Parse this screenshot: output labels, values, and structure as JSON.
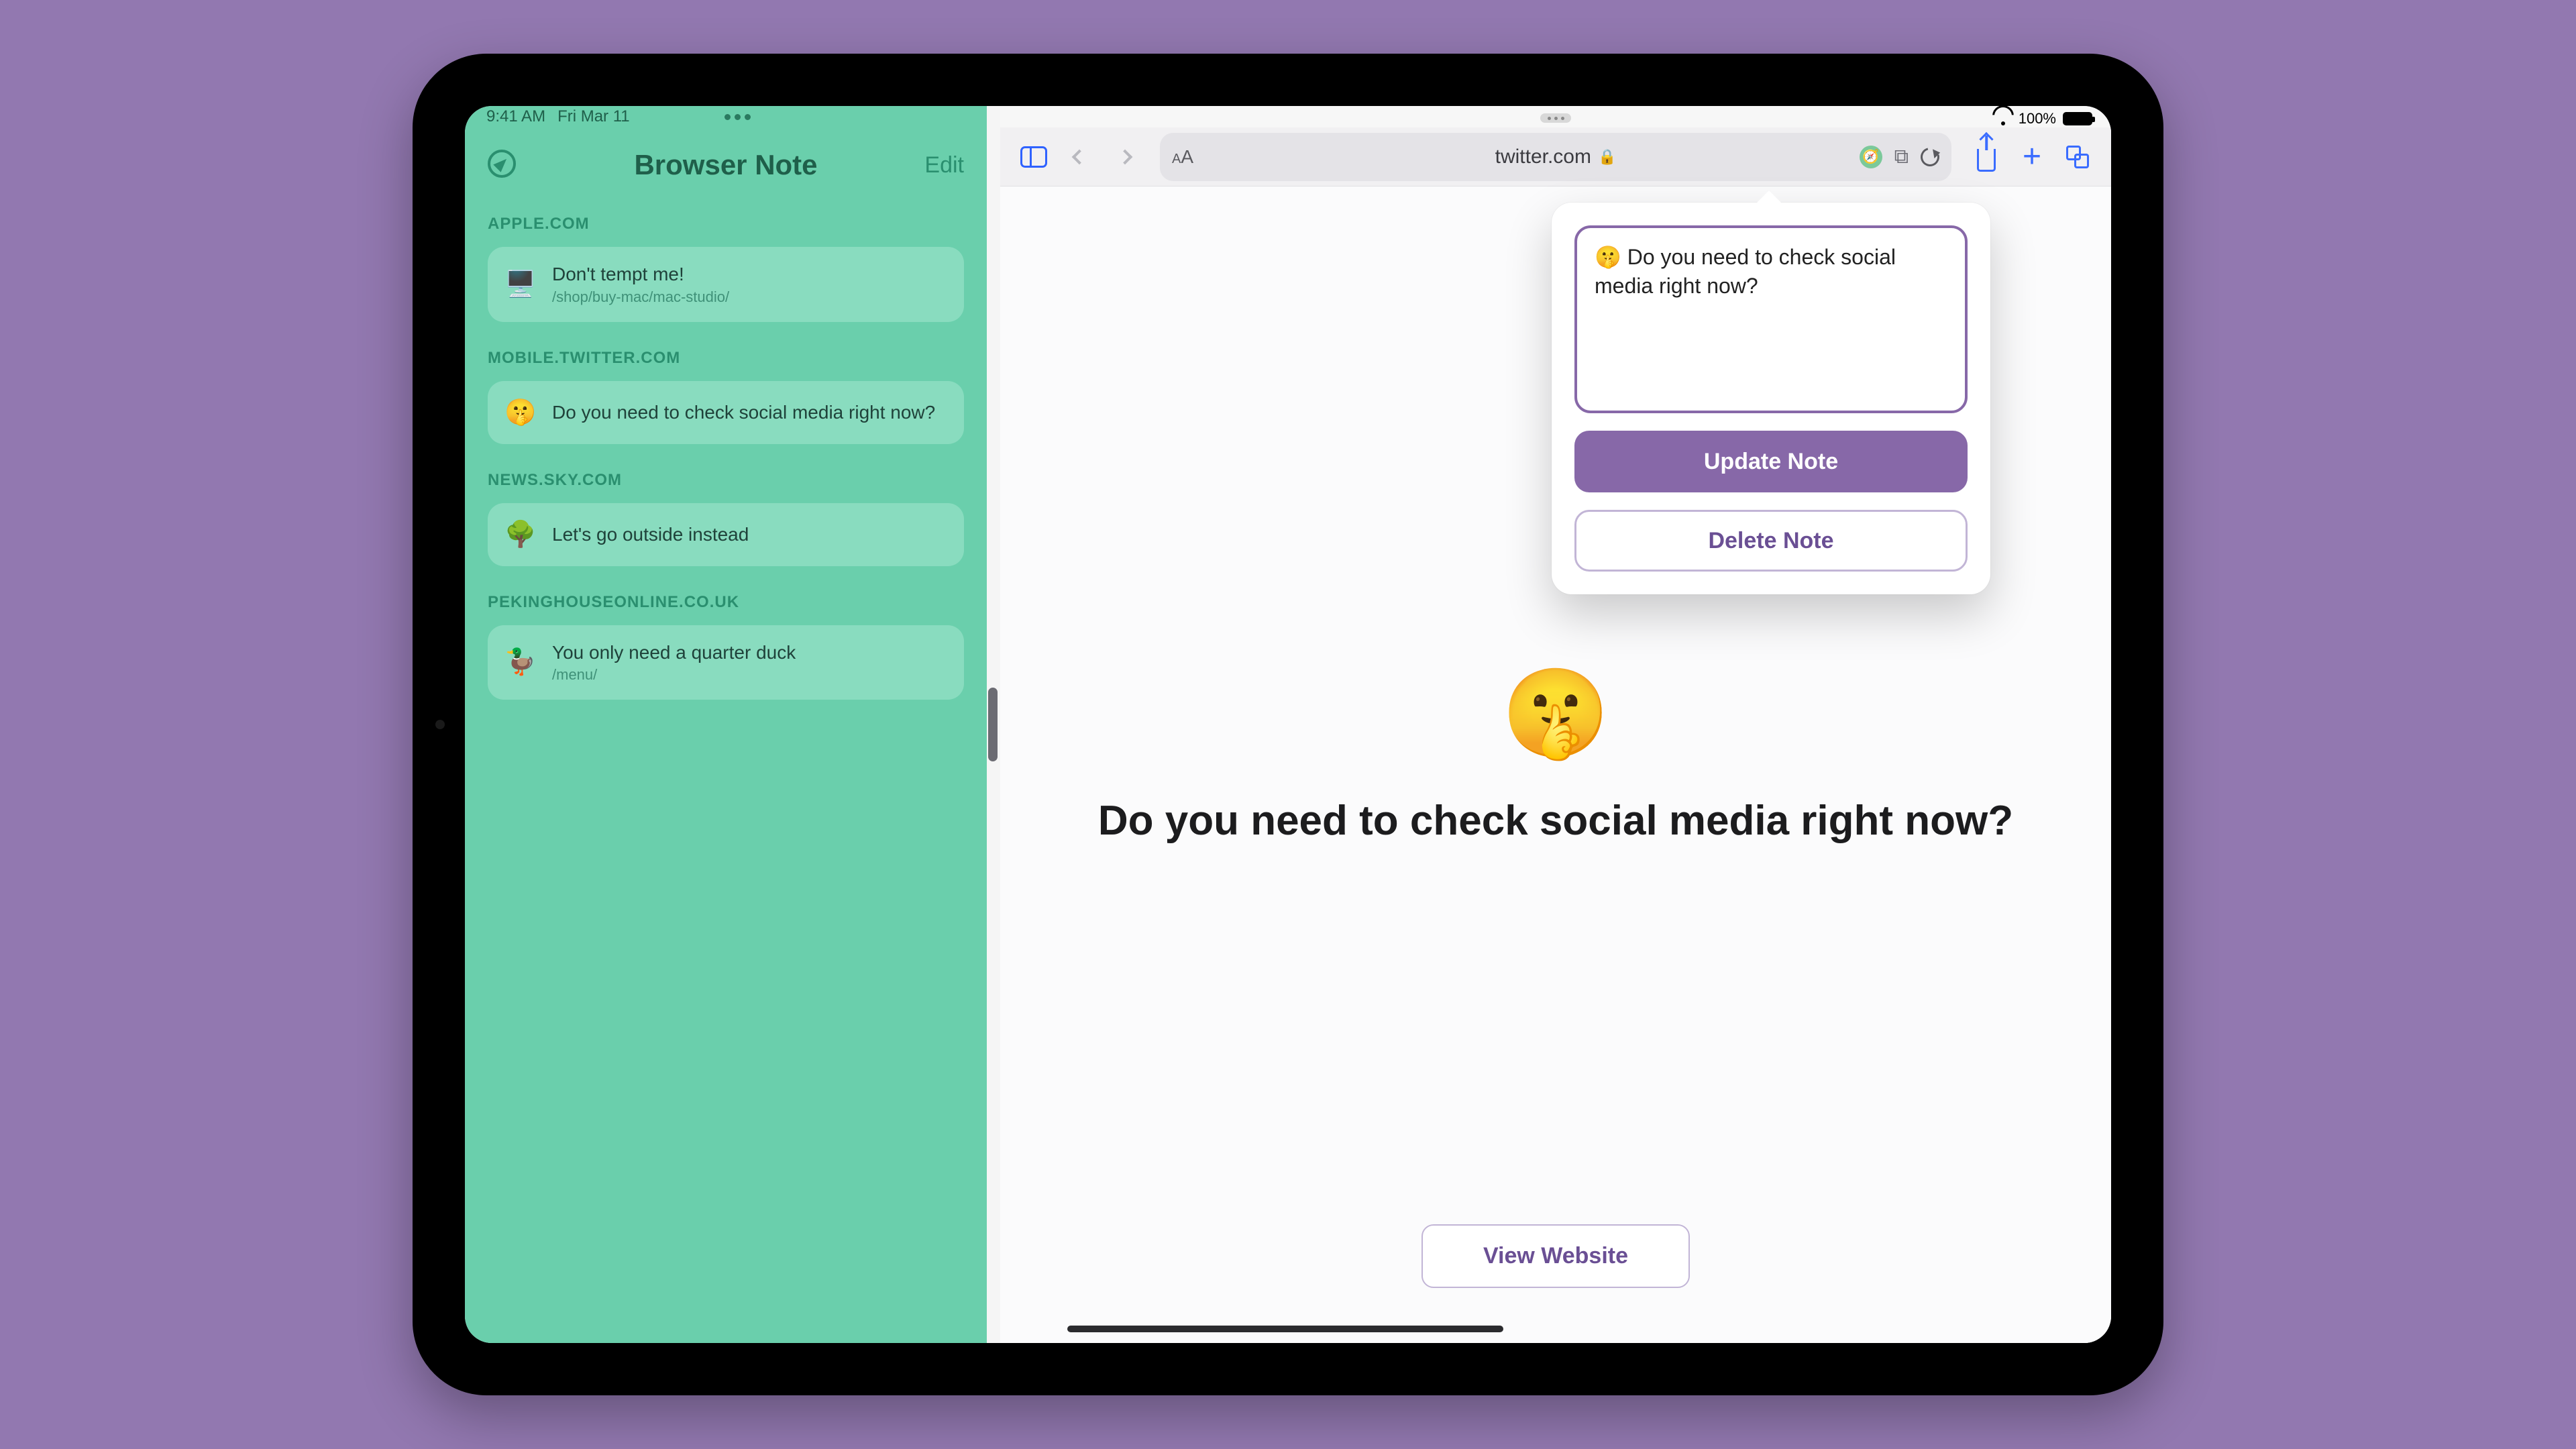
{
  "status": {
    "time": "9:41 AM",
    "date": "Fri Mar 11",
    "battery_pct": "100%"
  },
  "left_app": {
    "title": "Browser Note",
    "edit_label": "Edit",
    "sections": [
      {
        "domain": "APPLE.COM",
        "emoji": "🖥️",
        "title": "Don't tempt me!",
        "subtitle": "/shop/buy-mac/mac-studio/"
      },
      {
        "domain": "MOBILE.TWITTER.COM",
        "emoji": "🤫",
        "title": "Do you need to check social media right now?",
        "subtitle": ""
      },
      {
        "domain": "NEWS.SKY.COM",
        "emoji": "🌳",
        "title": "Let's go outside instead",
        "subtitle": ""
      },
      {
        "domain": "PEKINGHOUSEONLINE.CO.UK",
        "emoji": "🦆",
        "title": "You only need a quarter duck",
        "subtitle": "/menu/"
      }
    ]
  },
  "safari": {
    "url": "twitter.com",
    "page_emoji": "🤫",
    "page_question": "Do you need to check social media right now?",
    "view_website_label": "View Website"
  },
  "popover": {
    "note_text": "🤫 Do you need to check social media right now?",
    "update_label": "Update Note",
    "delete_label": "Delete Note"
  }
}
